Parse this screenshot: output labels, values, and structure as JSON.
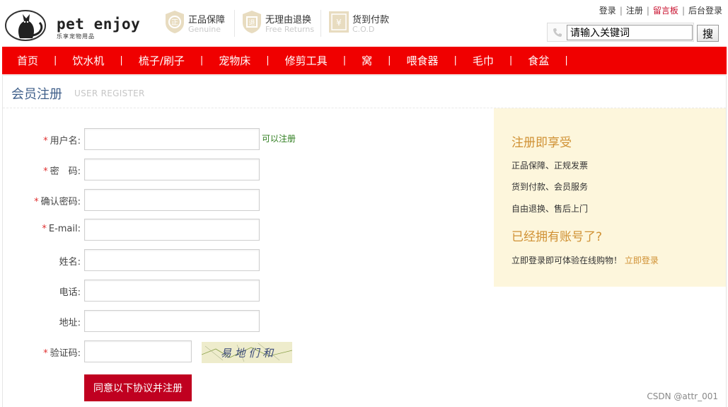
{
  "brand": {
    "logo_text": "pet enjoy",
    "logo_sub": "乐享宠物用品"
  },
  "promises": [
    {
      "icon": "genuine-icon",
      "glyph": "正",
      "title": "正品保障",
      "sub": "Genuine"
    },
    {
      "icon": "free-returns-icon",
      "glyph": "退",
      "title": "无理由退换",
      "sub": "Free Returns"
    },
    {
      "icon": "cod-icon",
      "glyph": "¥",
      "title": "货到付款",
      "sub": "C.O.D"
    }
  ],
  "top_links": {
    "login": "登录",
    "register": "注册",
    "message_board": "留言板",
    "admin_login": "后台登录",
    "separator": "|"
  },
  "search": {
    "value": "请输入关键词",
    "button": "搜"
  },
  "nav": {
    "items": [
      "首页",
      "饮水机",
      "梳子/刷子",
      "宠物床",
      "修剪工具",
      "窝",
      "喂食器",
      "毛巾",
      "食盆"
    ],
    "separator": "|"
  },
  "page": {
    "title": "会员注册",
    "title_en": "USER REGISTER"
  },
  "form": {
    "required_mark": "*",
    "username_label": "用户名:",
    "username_value": "",
    "username_status": "可以注册",
    "password_label": "密　码:",
    "confirm_label": "确认密码:",
    "email_label": "E-mail:",
    "name_label": "姓名:",
    "phone_label": "电话:",
    "address_label": "地址:",
    "captcha_label": "验证码:",
    "captcha_text": "易 地 们 和",
    "submit": "同意以下协议并注册"
  },
  "side": {
    "heading1": "注册即享受",
    "benefit1": "正品保障、正规发票",
    "benefit2": "货到付款、会员服务",
    "benefit3": "自由退换、售后上门",
    "heading2": "已经拥有账号了?",
    "login_prompt": "立即登录即可体验在线购物！",
    "login_link": "立即登录"
  },
  "watermark": "CSDN @attr_001",
  "colors": {
    "nav_red": "#f00000",
    "button_red": "#c00020",
    "side_bg": "#fdf6dc",
    "side_accent": "#d09134",
    "title_blue": "#3f5f8a"
  }
}
